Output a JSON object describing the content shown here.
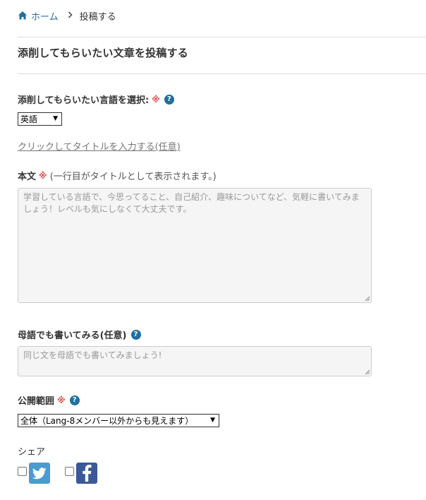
{
  "breadcrumb": {
    "home_label": "ホーム",
    "separator": "›",
    "current": "投稿する"
  },
  "page_title": "添削してもらいたい文章を投稿する",
  "language": {
    "label": "添削してもらいたい言語を選択:",
    "required_mark": "※",
    "help": "?",
    "selected": "英語"
  },
  "title_link": "クリックしてタイトルを入力する(任意)",
  "body": {
    "label": "本文",
    "required_mark": "※",
    "note": "(一行目がタイトルとして表示されます。)",
    "placeholder": "学習している言語で、今思ってること、自己紹介、趣味についてなど、気軽に書いてみましょう！レベルも気にしなくて大丈夫です。"
  },
  "native": {
    "label": "母語でも書いてみる(任意)",
    "help": "?",
    "placeholder": "同じ文を母語でも書いてみましょう!"
  },
  "visibility": {
    "label": "公開範囲",
    "required_mark": "※",
    "help": "?",
    "selected": "全体（Lang-8メンバー以外からも見えます）"
  },
  "share": {
    "label": "シェア",
    "twitter_checked": false,
    "facebook_checked": false
  },
  "colors": {
    "link": "#1f6f9f",
    "required": "#e05050",
    "twitter": "#4a9bd1",
    "facebook": "#3b5998"
  }
}
